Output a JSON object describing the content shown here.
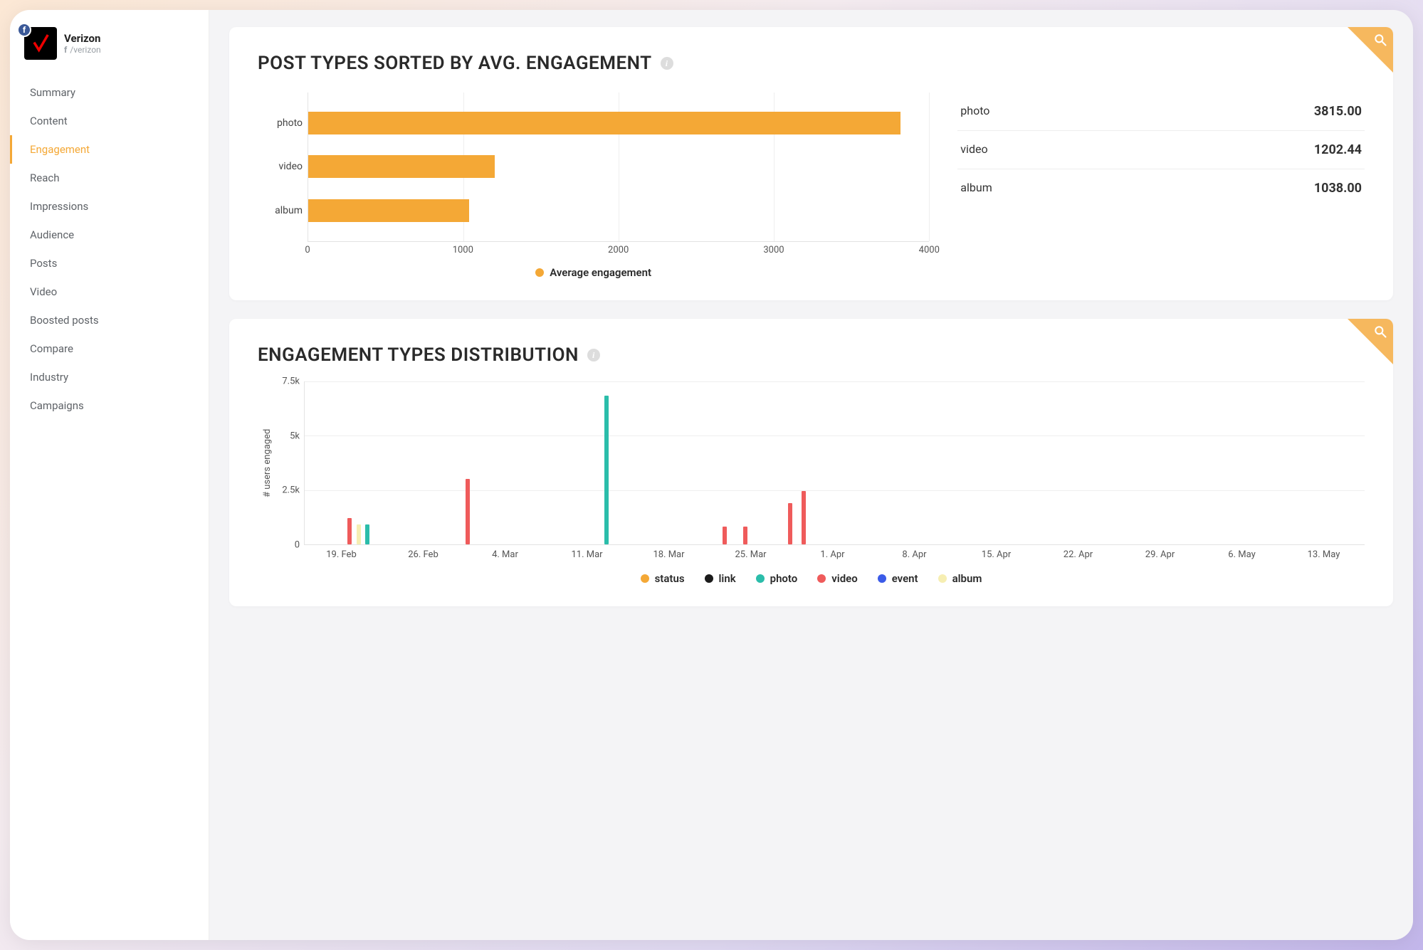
{
  "brand": {
    "name": "Verizon",
    "handle": "/verizon",
    "platform_icon": "f"
  },
  "sidebar": {
    "items": [
      {
        "label": "Summary"
      },
      {
        "label": "Content"
      },
      {
        "label": "Engagement"
      },
      {
        "label": "Reach"
      },
      {
        "label": "Impressions"
      },
      {
        "label": "Audience"
      },
      {
        "label": "Posts"
      },
      {
        "label": "Video"
      },
      {
        "label": "Boosted posts"
      },
      {
        "label": "Compare"
      },
      {
        "label": "Industry"
      },
      {
        "label": "Campaigns"
      }
    ],
    "active_index": 2
  },
  "card1": {
    "title": "POST TYPES SORTED BY AVG. ENGAGEMENT",
    "legend_label": "Average engagement",
    "stats": [
      {
        "label": "photo",
        "value": "3815.00"
      },
      {
        "label": "video",
        "value": "1202.44"
      },
      {
        "label": "album",
        "value": "1038.00"
      }
    ]
  },
  "card2": {
    "title": "ENGAGEMENT TYPES DISTRIBUTION",
    "ylabel": "# users engaged",
    "legend": [
      {
        "label": "status",
        "color": "#f4a836"
      },
      {
        "label": "link",
        "color": "#1b1b1b"
      },
      {
        "label": "photo",
        "color": "#2bbdaa"
      },
      {
        "label": "video",
        "color": "#ef5b5b"
      },
      {
        "label": "event",
        "color": "#3b5be8"
      },
      {
        "label": "album",
        "color": "#f6eeb2"
      }
    ]
  },
  "chart_data": [
    {
      "id": "post_types_avg_engagement",
      "type": "bar",
      "orientation": "horizontal",
      "categories": [
        "photo",
        "video",
        "album"
      ],
      "values": [
        3815.0,
        1202.44,
        1038.0
      ],
      "xlabel": "",
      "ylabel": "",
      "xlim": [
        0,
        4000
      ],
      "xticks": [
        0,
        1000,
        2000,
        3000,
        4000
      ],
      "legend": [
        "Average engagement"
      ],
      "colors": {
        "Average engagement": "#f4a836"
      }
    },
    {
      "id": "engagement_types_distribution",
      "type": "bar",
      "orientation": "vertical",
      "ylabel": "# users engaged",
      "ylim": [
        0,
        7500
      ],
      "yticks": [
        0,
        2500,
        5000,
        7500
      ],
      "ytick_labels": [
        "0",
        "2.5k",
        "5k",
        "7.5k"
      ],
      "xticks_labels": [
        "19. Feb",
        "26. Feb",
        "4. Mar",
        "11. Mar",
        "18. Mar",
        "25. Mar",
        "1. Apr",
        "8. Apr",
        "15. Apr",
        "22. Apr",
        "29. Apr",
        "6. May",
        "13. May"
      ],
      "series": [
        {
          "name": "status",
          "color": "#f4a836",
          "points": []
        },
        {
          "name": "link",
          "color": "#1b1b1b",
          "points": []
        },
        {
          "name": "photo",
          "color": "#2bbdaa",
          "points": [
            {
              "x_index_frac": 0.27,
              "value": 900
            },
            {
              "x_index_frac": 3.2,
              "value": 6800
            }
          ]
        },
        {
          "name": "video",
          "color": "#ef5b5b",
          "points": [
            {
              "x_index_frac": 0.05,
              "value": 1200
            },
            {
              "x_index_frac": 1.5,
              "value": 3000
            },
            {
              "x_index_frac": 4.65,
              "value": 800
            },
            {
              "x_index_frac": 4.9,
              "value": 800
            },
            {
              "x_index_frac": 5.45,
              "value": 1900
            },
            {
              "x_index_frac": 5.62,
              "value": 2450
            }
          ]
        },
        {
          "name": "event",
          "color": "#3b5be8",
          "points": []
        },
        {
          "name": "album",
          "color": "#f6eeb2",
          "points": [
            {
              "x_index_frac": 0.16,
              "value": 900
            }
          ]
        }
      ]
    }
  ]
}
